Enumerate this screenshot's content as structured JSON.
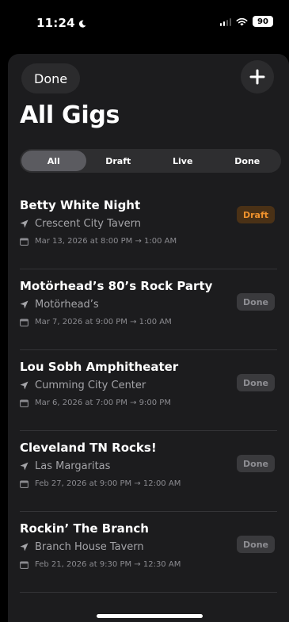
{
  "status_bar": {
    "time": "11:24",
    "battery": "90"
  },
  "header": {
    "done_label": "Done",
    "title": "All Gigs"
  },
  "filters": [
    {
      "label": "All",
      "active": true
    },
    {
      "label": "Draft",
      "active": false
    },
    {
      "label": "Live",
      "active": false
    },
    {
      "label": "Done",
      "active": false
    }
  ],
  "gigs": [
    {
      "name": "Betty White Night",
      "venue": "Crescent City Tavern",
      "date": "Mar 13, 2026 at 8:00 PM  →  1:00 AM",
      "status": "Draft"
    },
    {
      "name": "Motörhead’s 80’s Rock Party",
      "venue": "Motörhead’s",
      "date": "Mar 7, 2026 at 9:00 PM  →  1:00 AM",
      "status": "Done"
    },
    {
      "name": "Lou Sobh Amphitheater",
      "venue": "Cumming City Center",
      "date": "Mar 6, 2026 at 7:00 PM  →  9:00 PM",
      "status": "Done"
    },
    {
      "name": "Cleveland TN Rocks!",
      "venue": "Las Margaritas",
      "date": "Feb 27, 2026 at 9:00 PM  →  12:00 AM",
      "status": "Done"
    },
    {
      "name": "Rockin’ The Branch",
      "venue": "Branch House Tavern",
      "date": "Feb 21, 2026 at 9:30 PM  →  12:30 AM",
      "status": "Done"
    }
  ],
  "colors": {
    "background": "#000000",
    "sheet": "#1c1c1e",
    "draft_text": "#f0922d",
    "draft_bg": "#4a3116",
    "done_text": "#8e8e93",
    "done_bg": "#3a3a3d",
    "secondary_text": "#a4a4a8"
  },
  "icons": {
    "venue": "location-arrow-icon",
    "date": "calendar-icon",
    "add": "plus-icon",
    "moon": "moon-icon"
  }
}
